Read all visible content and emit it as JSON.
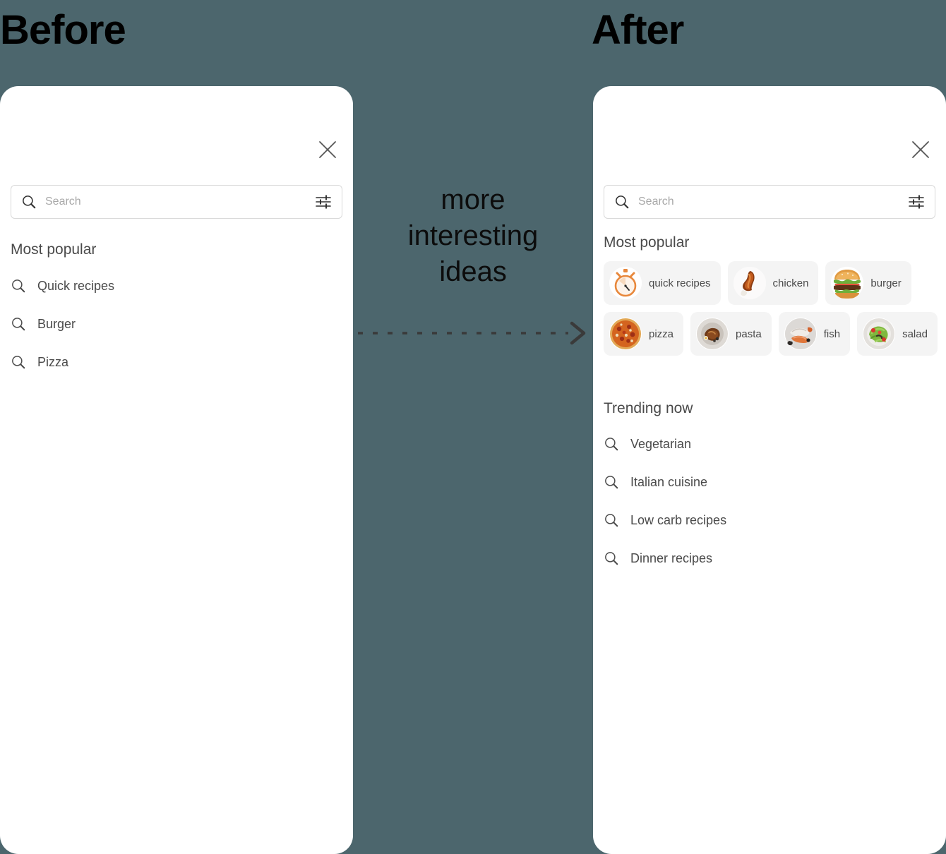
{
  "stages": {
    "before_title": "Before",
    "after_title": "After"
  },
  "middle": {
    "annotation_line1": "more",
    "annotation_line2": "interesting",
    "annotation_line3": "ideas",
    "arrow_icon": "dashed-arrow-right-icon"
  },
  "colors": {
    "background": "#4c666d",
    "card": "#ffffff",
    "chip_background": "#f4f4f4",
    "text_primary": "#4a4a4a",
    "placeholder": "#a8a8a8",
    "accent_orange": "#e8883c"
  },
  "before": {
    "close_icon": "close-icon",
    "search": {
      "placeholder": "Search",
      "value": "",
      "search_icon": "search-icon",
      "filter_icon": "filter-sliders-icon"
    },
    "section_title": "Most popular",
    "suggestions": [
      {
        "label": "Quick recipes",
        "icon": "search-icon"
      },
      {
        "label": "Burger",
        "icon": "search-icon"
      },
      {
        "label": "Pizza",
        "icon": "search-icon"
      }
    ]
  },
  "after": {
    "close_icon": "close-icon",
    "search": {
      "placeholder": "Search",
      "value": "",
      "search_icon": "search-icon",
      "filter_icon": "filter-sliders-icon"
    },
    "most_popular_title": "Most popular",
    "chips_row1": [
      {
        "label": "quick recipes",
        "thumb": "stopwatch-icon"
      },
      {
        "label": "chicken",
        "thumb": "chicken-drumstick-photo"
      },
      {
        "label": "burger",
        "thumb": "burger-photo"
      }
    ],
    "chips_row2": [
      {
        "label": "pizza",
        "thumb": "pizza-photo"
      },
      {
        "label": "pasta",
        "thumb": "pasta-photo"
      },
      {
        "label": "fish",
        "thumb": "fish-photo"
      },
      {
        "label": "salad",
        "thumb": "salad-photo"
      }
    ],
    "trending_title": "Trending now",
    "trending": [
      {
        "label": "Vegetarian",
        "icon": "search-icon"
      },
      {
        "label": "Italian cuisine",
        "icon": "search-icon"
      },
      {
        "label": "Low carb recipes",
        "icon": "search-icon"
      },
      {
        "label": "Dinner recipes",
        "icon": "search-icon"
      }
    ]
  }
}
